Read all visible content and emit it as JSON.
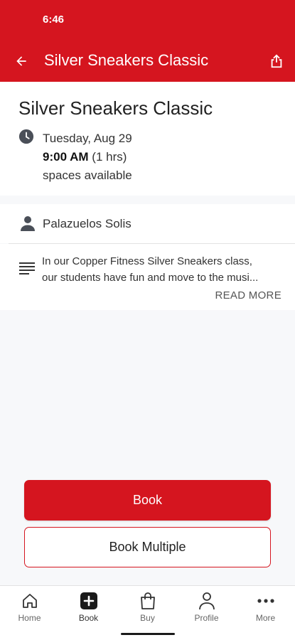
{
  "status_bar": {
    "time": "6:46"
  },
  "app_bar": {
    "title": "Silver Sneakers Classic"
  },
  "class": {
    "title": "Silver Sneakers Classic",
    "date": "Tuesday, Aug 29",
    "start_time": "9:00 AM",
    "duration": "(1 hrs)",
    "availability": "spaces available"
  },
  "instructor": {
    "name": "Palazuelos Solis"
  },
  "description": {
    "line1": "In our Copper Fitness Silver Sneakers class,",
    "line2": "our students have fun and move to the musi...",
    "read_more": "READ MORE"
  },
  "actions": {
    "book": "Book",
    "book_multiple": "Book Multiple"
  },
  "tabs": [
    {
      "label": "Home",
      "icon": "home-icon"
    },
    {
      "label": "Book",
      "icon": "plus-square-icon"
    },
    {
      "label": "Buy",
      "icon": "shopping-bag-icon"
    },
    {
      "label": "Profile",
      "icon": "person-icon"
    },
    {
      "label": "More",
      "icon": "more-dots-icon"
    }
  ],
  "colors": {
    "brand": "#d5151f",
    "background": "#f7f8fa"
  }
}
